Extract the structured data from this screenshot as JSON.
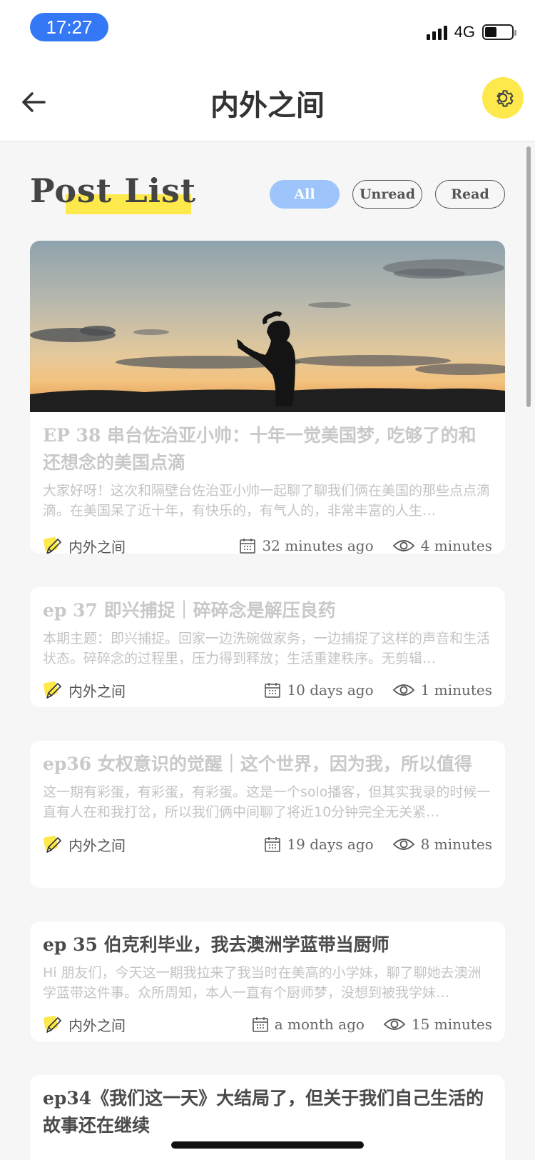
{
  "status_bar": {
    "time": "17:27",
    "network": "4G"
  },
  "nav": {
    "title": "内外之间"
  },
  "list": {
    "title": "Post List",
    "filters": [
      "All",
      "Unread",
      "Read"
    ],
    "active_filter": "All"
  },
  "posts": [
    {
      "title": "EP 38 串台佐治亚小帅：十年一觉美国梦, 吃够了的和还想念的美国点滴",
      "desc": "大家好呀！这次和隔壁台佐治亚小帅一起聊了聊我们俩在美国的那些点点滴滴。在美国呆了近十年，有快乐的，有气人的，非常丰富的人生…",
      "author": "内外之间",
      "date": "32 minutes ago",
      "duration": "4 minutes",
      "read": true,
      "has_image": true
    },
    {
      "title": "ep 37 即兴捕捉｜碎碎念是解压良药",
      "desc": "本期主题：即兴捕捉。回家一边洗碗做家务，一边捕捉了这样的声音和生活状态。碎碎念的过程里，压力得到释放；生活重建秩序。无剪辑…",
      "author": "内外之间",
      "date": "10 days ago",
      "duration": "1 minutes",
      "read": true,
      "has_image": false
    },
    {
      "title": "ep36 女权意识的觉醒｜这个世界，因为我，所以值得",
      "desc": "这一期有彩蛋，有彩蛋，有彩蛋。这是一个solo播客，但其实我录的时候一直有人在和我打岔，所以我们俩中间聊了将近10分钟完全无关紧…",
      "author": "内外之间",
      "date": "19 days ago",
      "duration": "8 minutes",
      "read": true,
      "has_image": false
    },
    {
      "title": "ep 35 伯克利毕业，我去澳洲学蓝带当厨师",
      "desc": "Hi 朋友们，今天这一期我拉来了我当时在美高的小学妹，聊了聊她去澳洲学蓝带这件事。众所周知，本人一直有个厨师梦，没想到被我学妹…",
      "author": "内外之间",
      "date": "a month ago",
      "duration": "15 minutes",
      "read": false,
      "has_image": false
    },
    {
      "title": "ep34《我们这一天》大结局了，但关于我们自己生活的故事还在继续",
      "read": false,
      "has_image": false
    }
  ],
  "colors": {
    "accent_yellow": "#fde94b",
    "accent_blue": "#9ec5fb",
    "time_pill": "#3478f6"
  }
}
